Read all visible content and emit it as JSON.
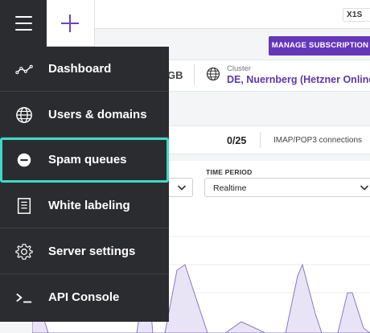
{
  "header": {
    "plan_badge": "X1S"
  },
  "subscription_button": "MANAGE SUBSCRIPTION",
  "info": {
    "storage_text": "GB",
    "cluster_label": "Cluster",
    "cluster_value": "DE, Nuernberg (Hetzner Online)"
  },
  "stats": {
    "count": "0/25",
    "label": "IMAP/POP3 connections"
  },
  "filters": {
    "time_period_label": "TIME PERIOD",
    "time_period_value": "Realtime"
  },
  "nav": {
    "items": [
      {
        "label": "Dashboard",
        "icon": "dashboard-icon"
      },
      {
        "label": "Users & domains",
        "icon": "globe-icon"
      },
      {
        "label": "Spam queues",
        "icon": "minus-circle-icon",
        "active": true
      },
      {
        "label": "White labeling",
        "icon": "document-icon"
      },
      {
        "label": "Server settings",
        "icon": "gear-icon"
      },
      {
        "label": "API Console",
        "icon": "terminal-icon"
      }
    ]
  },
  "colors": {
    "drawer_bg": "#2b2c30",
    "accent_purple": "#6536b8",
    "active_outline": "#3ddbc5"
  }
}
